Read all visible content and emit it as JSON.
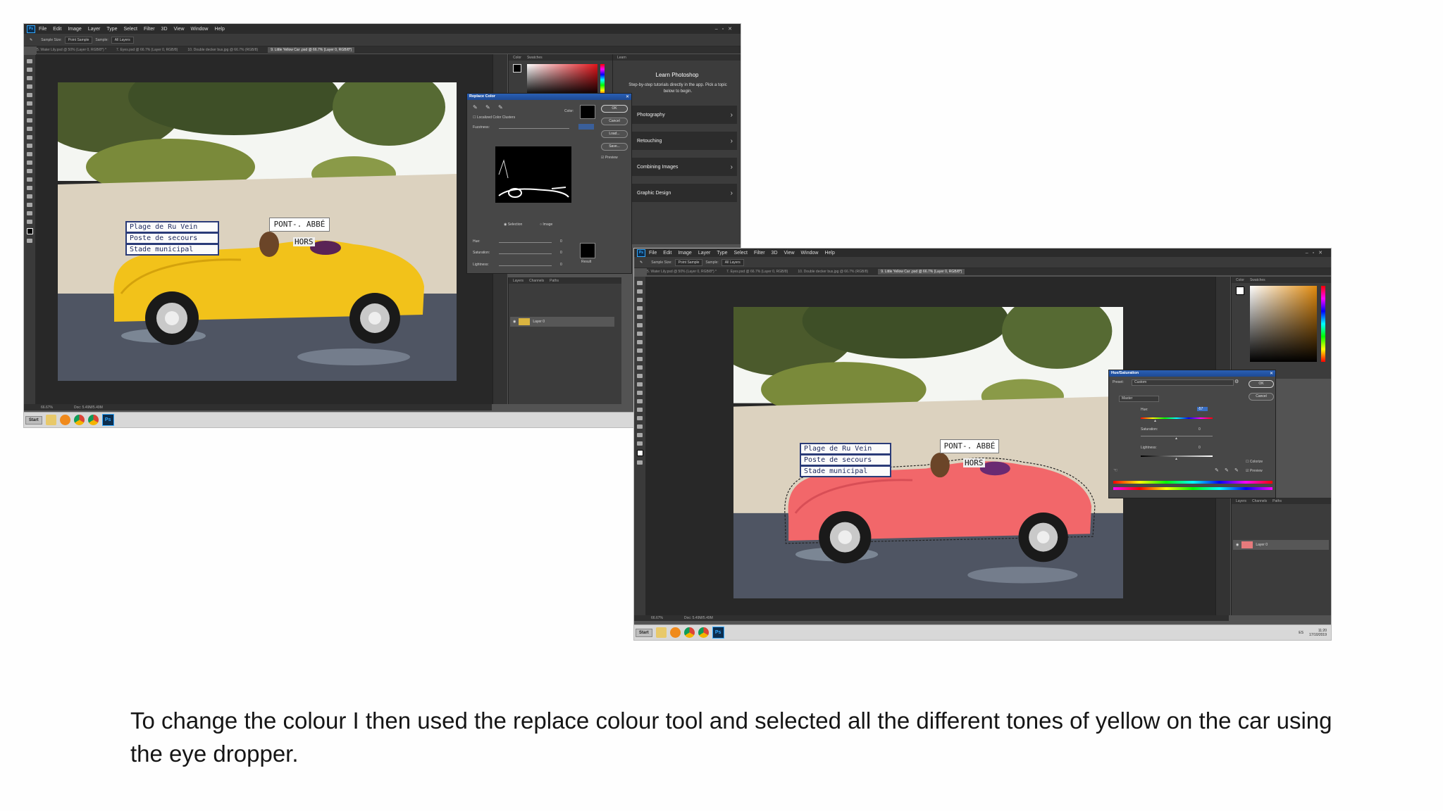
{
  "app": {
    "menu": [
      "File",
      "Edit",
      "Image",
      "Layer",
      "Type",
      "Select",
      "Filter",
      "3D",
      "View",
      "Window",
      "Help"
    ],
    "options_sample_size_label": "Sample Size:",
    "options_sample_size_value": "Point Sample",
    "options_sample_label": "Sample:",
    "options_sample_value": "All Layers",
    "doc_tabs": [
      "5. Water Lily.psd @ 50% (Layer 0, RGB/8*) *",
      "7. Eyes.psd @ 66.7% (Layer 0, RGB/8)",
      "10. Double decker bus.jpg @ 66.7% (RGB/8)",
      "9. Little Yellow Car .psd @ 66.7% (Layer 0, RGB/8*)"
    ],
    "status_zoom": "66.67%",
    "status_doc": "Doc: 5.49M/5.49M"
  },
  "photo": {
    "signs": [
      "Plage de Ru Vein",
      "Poste de secours",
      "Stade municipal"
    ],
    "road_sign": "PONT-. ABBÉ",
    "hors": "HORS",
    "colors": {
      "car_left": "#f2c21a",
      "car_right": "#f2676a",
      "sky": "#f4f6f2",
      "wall": "#dcd2bf",
      "road": "#4f5563"
    }
  },
  "screenshot1": {
    "color_panel_tabs": [
      "Color",
      "Swatches"
    ],
    "learn_tab": "Learn",
    "learn": {
      "title": "Learn Photoshop",
      "subtitle": "Step-by-step tutorials directly in the app. Pick a topic below to begin.",
      "items": [
        "Photography",
        "Retouching",
        "Combining Images",
        "Graphic Design"
      ]
    },
    "layers_tabs": [
      "Layers",
      "Channels",
      "Paths"
    ],
    "layer_name": "Layer 0",
    "replace_color": {
      "title": "Replace Color",
      "localized_label": "Localized Color Clusters",
      "color_label": "Color:",
      "fuzziness_label": "Fuzziness:",
      "selection_label": "Selection",
      "image_label": "Image",
      "hue_label": "Hue:",
      "saturation_label": "Saturation:",
      "lightness_label": "Lightness:",
      "hue_value": "0",
      "saturation_value": "0",
      "lightness_value": "0",
      "result_label": "Result",
      "ok": "OK",
      "cancel": "Cancel",
      "load": "Load...",
      "save": "Save...",
      "preview": "Preview"
    },
    "taskbar_start": "Start"
  },
  "screenshot2": {
    "color_panel_tabs": [
      "Color",
      "Swatches"
    ],
    "layers_tabs": [
      "Layers",
      "Channels",
      "Paths"
    ],
    "layer_name": "Layer 0",
    "hue_saturation": {
      "title": "Hue/Saturation",
      "preset_label": "Preset:",
      "preset_value": "Custom",
      "channel_value": "Master",
      "hue_label": "Hue:",
      "hue_value": "-57",
      "saturation_label": "Saturation:",
      "saturation_value": "0",
      "lightness_label": "Lightness:",
      "lightness_value": "0",
      "colorize": "Colorize",
      "preview": "Preview",
      "ok": "OK",
      "cancel": "Cancel"
    },
    "taskbar_start": "Start",
    "tray_lang": "ES",
    "tray_time": "11:20",
    "tray_date": "17/10/2019"
  },
  "caption": "To change the colour I then used the replace colour tool and selected all the different tones of yellow on the car using the eye dropper."
}
